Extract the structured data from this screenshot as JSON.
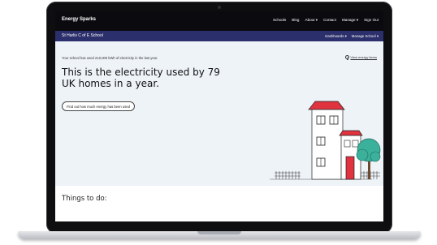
{
  "topnav": {
    "brand": "Energy Sparks",
    "links": [
      "Schools",
      "Blog",
      "About ▾",
      "Contact",
      "Manage ▾",
      "Sign Out"
    ]
  },
  "school_nav": {
    "name": "St Harlis C of E School",
    "links": [
      "Dashboards ▾",
      "Manage School ▾"
    ]
  },
  "hero": {
    "intro": "Your school has used 210,000 kWh of electricity in the last year.",
    "more_link": "View energy items",
    "headline": "This is the electricity used by 79 UK homes in a year.",
    "cta": "Find out how much energy has been used"
  },
  "todo": {
    "title": "Things to do:"
  },
  "colors": {
    "topnav_bg": "#0b0b0f",
    "school_nav_bg": "#2b2f6b",
    "hero_bg": "#eef3f8",
    "roof": "#e0323f",
    "tree": "#3bb19b"
  },
  "icons": [
    "question-circle-icon",
    "house-illustration",
    "tree-illustration",
    "fence-illustration"
  ]
}
